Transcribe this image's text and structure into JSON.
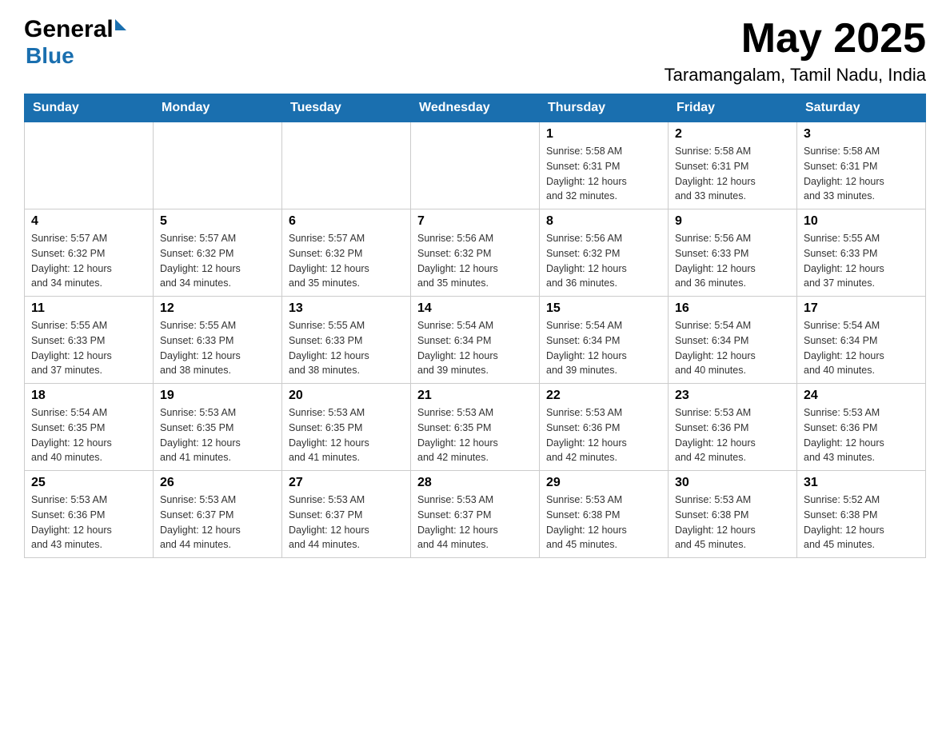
{
  "header": {
    "logo_general": "General",
    "logo_blue": "Blue",
    "main_title": "May 2025",
    "subtitle": "Taramangalam, Tamil Nadu, India"
  },
  "days_of_week": [
    "Sunday",
    "Monday",
    "Tuesday",
    "Wednesday",
    "Thursday",
    "Friday",
    "Saturday"
  ],
  "weeks": [
    {
      "days": [
        {
          "num": "",
          "info": ""
        },
        {
          "num": "",
          "info": ""
        },
        {
          "num": "",
          "info": ""
        },
        {
          "num": "",
          "info": ""
        },
        {
          "num": "1",
          "info": "Sunrise: 5:58 AM\nSunset: 6:31 PM\nDaylight: 12 hours\nand 32 minutes."
        },
        {
          "num": "2",
          "info": "Sunrise: 5:58 AM\nSunset: 6:31 PM\nDaylight: 12 hours\nand 33 minutes."
        },
        {
          "num": "3",
          "info": "Sunrise: 5:58 AM\nSunset: 6:31 PM\nDaylight: 12 hours\nand 33 minutes."
        }
      ]
    },
    {
      "days": [
        {
          "num": "4",
          "info": "Sunrise: 5:57 AM\nSunset: 6:32 PM\nDaylight: 12 hours\nand 34 minutes."
        },
        {
          "num": "5",
          "info": "Sunrise: 5:57 AM\nSunset: 6:32 PM\nDaylight: 12 hours\nand 34 minutes."
        },
        {
          "num": "6",
          "info": "Sunrise: 5:57 AM\nSunset: 6:32 PM\nDaylight: 12 hours\nand 35 minutes."
        },
        {
          "num": "7",
          "info": "Sunrise: 5:56 AM\nSunset: 6:32 PM\nDaylight: 12 hours\nand 35 minutes."
        },
        {
          "num": "8",
          "info": "Sunrise: 5:56 AM\nSunset: 6:32 PM\nDaylight: 12 hours\nand 36 minutes."
        },
        {
          "num": "9",
          "info": "Sunrise: 5:56 AM\nSunset: 6:33 PM\nDaylight: 12 hours\nand 36 minutes."
        },
        {
          "num": "10",
          "info": "Sunrise: 5:55 AM\nSunset: 6:33 PM\nDaylight: 12 hours\nand 37 minutes."
        }
      ]
    },
    {
      "days": [
        {
          "num": "11",
          "info": "Sunrise: 5:55 AM\nSunset: 6:33 PM\nDaylight: 12 hours\nand 37 minutes."
        },
        {
          "num": "12",
          "info": "Sunrise: 5:55 AM\nSunset: 6:33 PM\nDaylight: 12 hours\nand 38 minutes."
        },
        {
          "num": "13",
          "info": "Sunrise: 5:55 AM\nSunset: 6:33 PM\nDaylight: 12 hours\nand 38 minutes."
        },
        {
          "num": "14",
          "info": "Sunrise: 5:54 AM\nSunset: 6:34 PM\nDaylight: 12 hours\nand 39 minutes."
        },
        {
          "num": "15",
          "info": "Sunrise: 5:54 AM\nSunset: 6:34 PM\nDaylight: 12 hours\nand 39 minutes."
        },
        {
          "num": "16",
          "info": "Sunrise: 5:54 AM\nSunset: 6:34 PM\nDaylight: 12 hours\nand 40 minutes."
        },
        {
          "num": "17",
          "info": "Sunrise: 5:54 AM\nSunset: 6:34 PM\nDaylight: 12 hours\nand 40 minutes."
        }
      ]
    },
    {
      "days": [
        {
          "num": "18",
          "info": "Sunrise: 5:54 AM\nSunset: 6:35 PM\nDaylight: 12 hours\nand 40 minutes."
        },
        {
          "num": "19",
          "info": "Sunrise: 5:53 AM\nSunset: 6:35 PM\nDaylight: 12 hours\nand 41 minutes."
        },
        {
          "num": "20",
          "info": "Sunrise: 5:53 AM\nSunset: 6:35 PM\nDaylight: 12 hours\nand 41 minutes."
        },
        {
          "num": "21",
          "info": "Sunrise: 5:53 AM\nSunset: 6:35 PM\nDaylight: 12 hours\nand 42 minutes."
        },
        {
          "num": "22",
          "info": "Sunrise: 5:53 AM\nSunset: 6:36 PM\nDaylight: 12 hours\nand 42 minutes."
        },
        {
          "num": "23",
          "info": "Sunrise: 5:53 AM\nSunset: 6:36 PM\nDaylight: 12 hours\nand 42 minutes."
        },
        {
          "num": "24",
          "info": "Sunrise: 5:53 AM\nSunset: 6:36 PM\nDaylight: 12 hours\nand 43 minutes."
        }
      ]
    },
    {
      "days": [
        {
          "num": "25",
          "info": "Sunrise: 5:53 AM\nSunset: 6:36 PM\nDaylight: 12 hours\nand 43 minutes."
        },
        {
          "num": "26",
          "info": "Sunrise: 5:53 AM\nSunset: 6:37 PM\nDaylight: 12 hours\nand 44 minutes."
        },
        {
          "num": "27",
          "info": "Sunrise: 5:53 AM\nSunset: 6:37 PM\nDaylight: 12 hours\nand 44 minutes."
        },
        {
          "num": "28",
          "info": "Sunrise: 5:53 AM\nSunset: 6:37 PM\nDaylight: 12 hours\nand 44 minutes."
        },
        {
          "num": "29",
          "info": "Sunrise: 5:53 AM\nSunset: 6:38 PM\nDaylight: 12 hours\nand 45 minutes."
        },
        {
          "num": "30",
          "info": "Sunrise: 5:53 AM\nSunset: 6:38 PM\nDaylight: 12 hours\nand 45 minutes."
        },
        {
          "num": "31",
          "info": "Sunrise: 5:52 AM\nSunset: 6:38 PM\nDaylight: 12 hours\nand 45 minutes."
        }
      ]
    }
  ]
}
